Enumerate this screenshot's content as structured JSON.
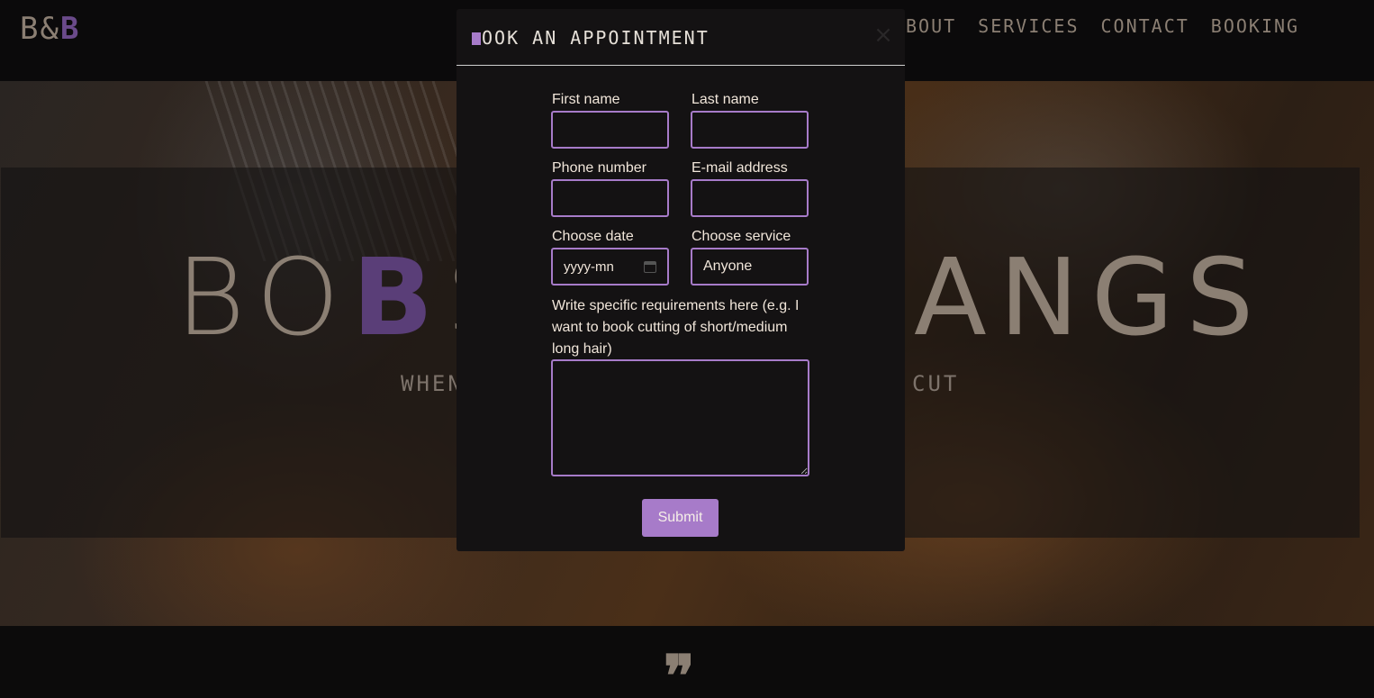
{
  "header": {
    "logo": {
      "prefix": "B&",
      "accent": "B"
    },
    "nav": [
      "BOUT",
      "SERVICES",
      "CONTACT",
      "BOOKING"
    ]
  },
  "hero": {
    "title_left": "BO",
    "title_accent": "B",
    "title_mid": "S",
    "title_right": "ANGS",
    "subtitle_left": "WHEN",
    "subtitle_right": "CUT"
  },
  "quote_mark": "❞",
  "modal": {
    "title_accent": "B",
    "title": "OOK AN APPOINTMENT",
    "close_glyph": "×",
    "fields": {
      "first_name": {
        "label": "First name",
        "value": ""
      },
      "last_name": {
        "label": "Last name",
        "value": ""
      },
      "phone": {
        "label": "Phone number",
        "value": ""
      },
      "email": {
        "label": "E-mail address",
        "value": ""
      },
      "date": {
        "label": "Choose date",
        "placeholder": "yyyy-mn"
      },
      "service": {
        "label": "Choose service",
        "selected": "Anyone"
      },
      "requirements": {
        "label": "Write specific requirements here (e.g. I want to book cutting of short/medium long hair)",
        "value": ""
      }
    },
    "submit_label": "Submit"
  },
  "colors": {
    "accent": "#a77bc9",
    "text": "#f1e6da",
    "muted": "#8b7f73",
    "modal_bg": "#141213"
  }
}
